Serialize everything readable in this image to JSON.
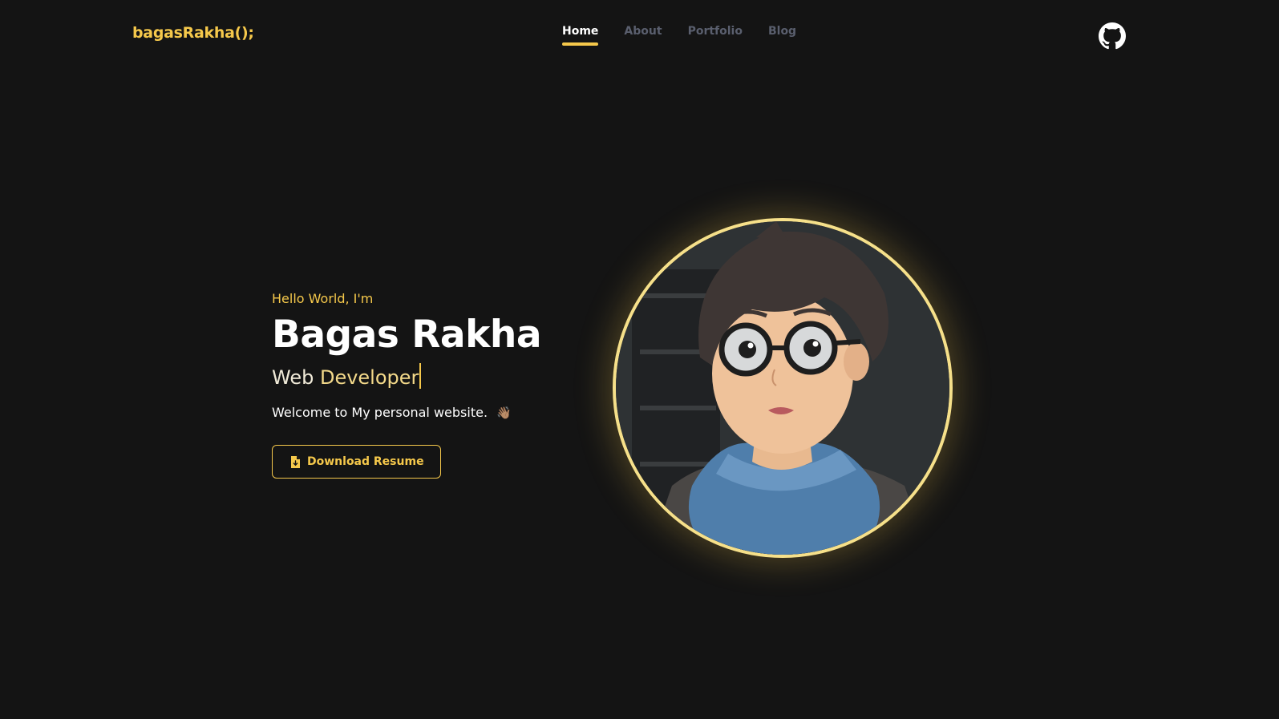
{
  "header": {
    "logo": "bagasRakha();",
    "nav": [
      {
        "label": "Home",
        "active": true
      },
      {
        "label": "About",
        "active": false
      },
      {
        "label": "Portfolio",
        "active": false
      },
      {
        "label": "Blog",
        "active": false
      }
    ],
    "github_icon": "github-icon"
  },
  "hero": {
    "greeting": "Hello World, I'm",
    "name": "Bagas Rakha",
    "role_prefix": "Web",
    "role_word": "Developer",
    "welcome": "Welcome to My personal website.",
    "wave_icon": "👋🏽",
    "resume_button": "Download Resume",
    "resume_icon": "file-download-icon",
    "avatar": "anime-boy-with-glasses-avatar"
  },
  "colors": {
    "background": "#141414",
    "accent": "#f5c84b",
    "nav_inactive": "#5a5f6e",
    "text": "#ffffff"
  }
}
